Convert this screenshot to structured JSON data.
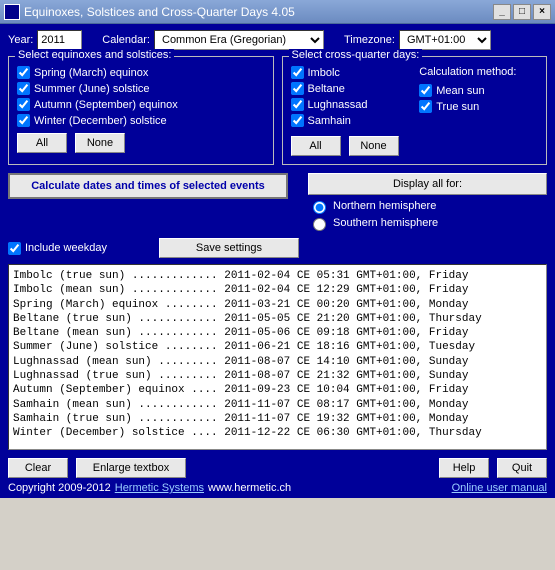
{
  "title": "Equinoxes, Solstices and Cross-Quarter Days 4.05",
  "toprow": {
    "year_label": "Year:",
    "year_value": "2011",
    "calendar_label": "Calendar:",
    "calendar_value": "Common Era (Gregorian)",
    "tz_label": "Timezone:",
    "tz_value": "GMT+01:00"
  },
  "group_eq": {
    "legend": "Select equinoxes and solstices:",
    "items": [
      "Spring (March) equinox",
      "Summer (June) solstice",
      "Autumn (September) equinox",
      "Winter (December) solstice"
    ],
    "all": "All",
    "none": "None"
  },
  "group_cq": {
    "legend": "Select cross-quarter days:",
    "items": [
      "Imbolc",
      "Beltane",
      "Lughnassad",
      "Samhain"
    ],
    "calc_label": "Calculation method:",
    "methods": [
      "Mean sun",
      "True sun"
    ],
    "all": "All",
    "none": "None"
  },
  "calc_button": "Calculate dates and times of selected events",
  "display_all": "Display all for:",
  "hemisphere": {
    "north": "Northern hemisphere",
    "south": "Southern hemisphere"
  },
  "include_weekday": "Include weekday",
  "save_settings": "Save settings",
  "output_lines": [
    "Imbolc (true sun) ............. 2011-02-04 CE 05:31 GMT+01:00, Friday",
    "Imbolc (mean sun) ............. 2011-02-04 CE 12:29 GMT+01:00, Friday",
    "Spring (March) equinox ........ 2011-03-21 CE 00:20 GMT+01:00, Monday",
    "Beltane (true sun) ............ 2011-05-05 CE 21:20 GMT+01:00, Thursday",
    "Beltane (mean sun) ............ 2011-05-06 CE 09:18 GMT+01:00, Friday",
    "Summer (June) solstice ........ 2011-06-21 CE 18:16 GMT+01:00, Tuesday",
    "Lughnassad (mean sun) ......... 2011-08-07 CE 14:10 GMT+01:00, Sunday",
    "Lughnassad (true sun) ......... 2011-08-07 CE 21:32 GMT+01:00, Sunday",
    "Autumn (September) equinox .... 2011-09-23 CE 10:04 GMT+01:00, Friday",
    "Samhain (mean sun) ............ 2011-11-07 CE 08:17 GMT+01:00, Monday",
    "Samhain (true sun) ............ 2011-11-07 CE 19:32 GMT+01:00, Monday",
    "Winter (December) solstice .... 2011-12-22 CE 06:30 GMT+01:00, Thursday"
  ],
  "clear": "Clear",
  "enlarge": "Enlarge textbox",
  "help": "Help",
  "quit": "Quit",
  "footer": {
    "copyright": "Copyright 2009-2012 ",
    "company": "Hermetic Systems",
    "url": " www.hermetic.ch",
    "manual": "Online user manual"
  }
}
